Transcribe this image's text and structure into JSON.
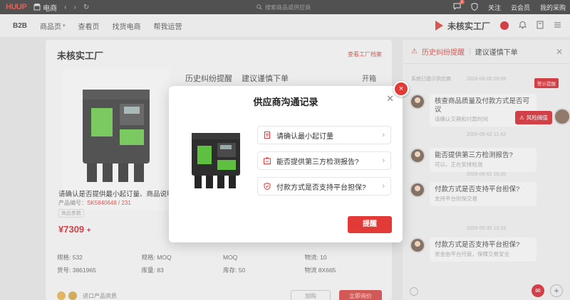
{
  "topbar": {
    "logo": "HUUP",
    "site_name": "电商",
    "search_placeholder": "搜索商品或供应商",
    "right_items": [
      "关注",
      "云会员",
      "我的采购"
    ],
    "notify_count": "2"
  },
  "navbar": {
    "items": [
      "B2B",
      "商品页",
      "查看页",
      "找货电商",
      "帮我运营"
    ],
    "factory": "未核实工厂"
  },
  "main": {
    "title": "未核实工厂",
    "sub_link": "查看工厂档案",
    "section_tabs": [
      "历史纠纷提醒",
      "建议谨慎下单"
    ],
    "section_more": "开箱",
    "product_name": "请确认是否提供最小起订量、商品说明",
    "product_meta_label": "产品编号：",
    "product_meta_value": "SK5840648 / 231",
    "tag": "商品参数",
    "price": "¥7309",
    "specs": [
      [
        "规格: 532",
        "规格: MOQ",
        "MOQ",
        "物流: 10"
      ],
      [
        "货号: 3861965",
        "库量: 83",
        "库存: 50",
        "物流 8X665"
      ]
    ],
    "bottom_note": "进口产品资质",
    "bottom_ghost": "加购",
    "bottom_red": "立即询价"
  },
  "chat": {
    "tab_active": "历史纠纷提醒",
    "tab_other": "建议谨慎下单",
    "sys_note": "系统已提示供应商",
    "sys_button": "警示提醒",
    "times": [
      "2020-06-05 09:08",
      "2020-06-02 11:42",
      "2020-06-01 16:20",
      "2020-05-30 10:15"
    ],
    "messages": [
      {
        "q": "核查商品质量及付款方式是否可议",
        "a": "请确认交期和付款时间"
      },
      {
        "q": "能否提供第三方检测报告?",
        "a": "可以，正在安排检测"
      },
      {
        "q": "付款方式是否支持平台担保?",
        "a": "支持平台担保交易"
      },
      {
        "q": "付款方式是否支持平台担保?",
        "a": "资金由平台托管，保障交易安全"
      }
    ],
    "risk_label": "风险阈值"
  },
  "modal": {
    "title": "供应商沟通记录",
    "close_icon": "close-icon",
    "options": [
      "请确认最小起订量",
      "能否提供第三方检测报告?",
      "付款方式是否支持平台担保?"
    ],
    "reply_button": "提醒",
    "badge_icon": "×"
  },
  "colors": {
    "brand_red": "#e23b37",
    "deep_red": "#c7171e",
    "device_green": "#5fbf3f"
  }
}
